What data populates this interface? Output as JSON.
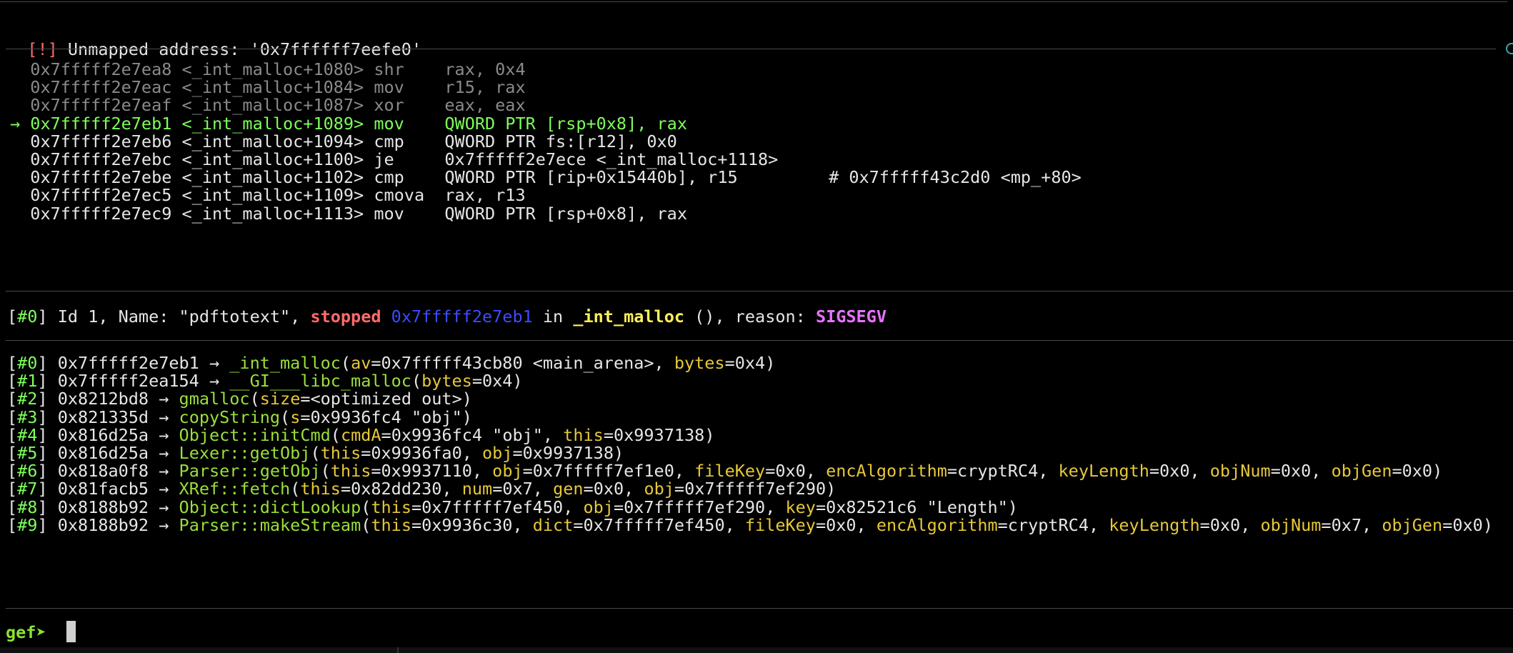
{
  "header": {
    "flag": "[!]",
    "message": "Unmapped address: '0x7ffffff7eefe0'"
  },
  "code": {
    "arrow": "→",
    "lines": [
      {
        "addr": "0x7fffff2e7ea8",
        "sym": "<_int_malloc+1080>",
        "op": "shr  ",
        "args": "rax, 0x4",
        "comment": "",
        "state": "past"
      },
      {
        "addr": "0x7fffff2e7eac",
        "sym": "<_int_malloc+1084>",
        "op": "mov  ",
        "args": "r15, rax",
        "comment": "",
        "state": "past"
      },
      {
        "addr": "0x7fffff2e7eaf",
        "sym": "<_int_malloc+1087>",
        "op": "xor  ",
        "args": "eax, eax",
        "comment": "",
        "state": "past"
      },
      {
        "addr": "0x7fffff2e7eb1",
        "sym": "<_int_malloc+1089>",
        "op": "mov  ",
        "args": "QWORD PTR [rsp+0x8], rax",
        "comment": "",
        "state": "current"
      },
      {
        "addr": "0x7fffff2e7eb6",
        "sym": "<_int_malloc+1094>",
        "op": "cmp  ",
        "args": "QWORD PTR fs:[r12], 0x0",
        "comment": "",
        "state": "next"
      },
      {
        "addr": "0x7fffff2e7ebc",
        "sym": "<_int_malloc+1100>",
        "op": "je   ",
        "args": "0x7fffff2e7ece <_int_malloc+1118>",
        "comment": "",
        "state": "next"
      },
      {
        "addr": "0x7fffff2e7ebe",
        "sym": "<_int_malloc+1102>",
        "op": "cmp  ",
        "args": "QWORD PTR [rip+0x15440b], r15",
        "comment": "# 0x7fffff43c2d0 <mp_+80>",
        "state": "next"
      },
      {
        "addr": "0x7fffff2e7ec5",
        "sym": "<_int_malloc+1109>",
        "op": "cmova",
        "args": "rax, r13",
        "comment": "",
        "state": "next"
      },
      {
        "addr": "0x7fffff2e7ec9",
        "sym": "<_int_malloc+1113>",
        "op": "mov  ",
        "args": "QWORD PTR [rsp+0x8], rax",
        "comment": "",
        "state": "next"
      }
    ]
  },
  "thread": {
    "index": "#0",
    "prefix": "Id 1, Name: \"pdftotext\", ",
    "status": "stopped",
    "address": "0x7fffff2e7eb1",
    "in_text": "in",
    "function": "_int_malloc",
    "paren": "()",
    "reason_label": ", reason: ",
    "reason": "SIGSEGV"
  },
  "trace": {
    "frames": [
      {
        "idx": "#0",
        "addr": "0x7fffff2e7eb1",
        "fn": "_int_malloc",
        "args": [
          [
            "av",
            "0x7fffff43cb80 <main_arena>"
          ],
          [
            "bytes",
            "0x4"
          ]
        ]
      },
      {
        "idx": "#1",
        "addr": "0x7fffff2ea154",
        "fn": "__GI___libc_malloc",
        "args": [
          [
            "bytes",
            "0x4"
          ]
        ]
      },
      {
        "idx": "#2",
        "addr": "0x8212bd8",
        "fn": "gmalloc",
        "args": [
          [
            "size",
            "<optimized out>"
          ]
        ]
      },
      {
        "idx": "#3",
        "addr": "0x821335d",
        "fn": "copyString",
        "args": [
          [
            "s",
            "0x9936fc4 \"obj\""
          ]
        ]
      },
      {
        "idx": "#4",
        "addr": "0x816d25a",
        "fn": "Object::initCmd",
        "args": [
          [
            "cmdA",
            "0x9936fc4 \"obj\""
          ],
          [
            "this",
            "0x9937138"
          ]
        ]
      },
      {
        "idx": "#5",
        "addr": "0x816d25a",
        "fn": "Lexer::getObj",
        "args": [
          [
            "this",
            "0x9936fa0"
          ],
          [
            "obj",
            "0x9937138"
          ]
        ]
      },
      {
        "idx": "#6",
        "addr": "0x818a0f8",
        "fn": "Parser::getObj",
        "args": [
          [
            "this",
            "0x9937110"
          ],
          [
            "obj",
            "0x7fffff7ef1e0"
          ],
          [
            "fileKey",
            "0x0"
          ],
          [
            "encAlgorithm",
            "cryptRC4"
          ],
          [
            "keyLength",
            "0x0"
          ],
          [
            "objNum",
            "0x0"
          ],
          [
            "objGen",
            "0x0"
          ]
        ]
      },
      {
        "idx": "#7",
        "addr": "0x81facb5",
        "fn": "XRef::fetch",
        "args": [
          [
            "this",
            "0x82dd230"
          ],
          [
            "num",
            "0x7"
          ],
          [
            "gen",
            "0x0"
          ],
          [
            "obj",
            "0x7fffff7ef290"
          ]
        ]
      },
      {
        "idx": "#8",
        "addr": "0x8188b92",
        "fn": "Object::dictLookup",
        "args": [
          [
            "this",
            "0x7fffff7ef450"
          ],
          [
            "obj",
            "0x7fffff7ef290"
          ],
          [
            "key",
            "0x82521c6 \"Length\""
          ]
        ]
      },
      {
        "idx": "#9",
        "addr": "0x8188b92",
        "fn": "Parser::makeStream",
        "args": [
          [
            "this",
            "0x9936c30"
          ],
          [
            "dict",
            "0x7fffff7ef450"
          ],
          [
            "fileKey",
            "0x0"
          ],
          [
            "encAlgorithm",
            "cryptRC4"
          ],
          [
            "keyLength",
            "0x0"
          ],
          [
            "objNum",
            "0x7"
          ],
          [
            "objGen",
            "0x0"
          ]
        ]
      }
    ]
  },
  "prompt": {
    "label": "gef➤"
  },
  "colors": {
    "background": "#000000",
    "current_line": "#7dff5a",
    "past_line": "#8a8a8a",
    "stopped": "#ff6b6b",
    "address_blue": "#3b4cff",
    "function_green": "#9adf3b",
    "arg_yellow": "#e6c83a",
    "signal_magenta": "#e873ff"
  }
}
